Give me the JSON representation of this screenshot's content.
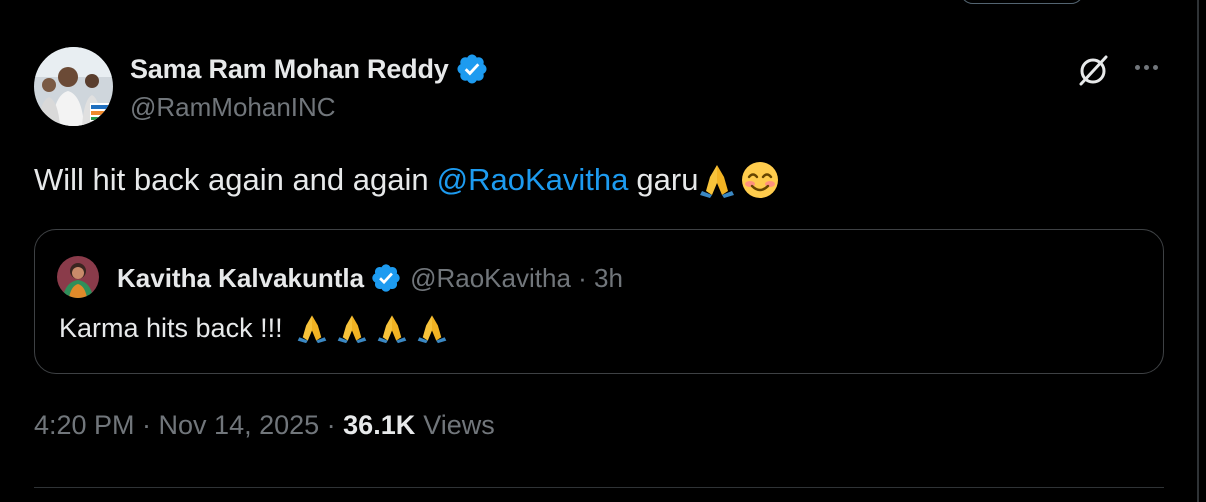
{
  "author": {
    "name": "Sama Ram Mohan Reddy",
    "handle": "@RamMohanINC"
  },
  "tweet": {
    "text_prefix": "Will hit back again and again",
    "mention": "@RaoKavitha",
    "text_suffix": "garu",
    "emojis": [
      "folded-hands",
      "smiling-face-with-smiling-eyes"
    ]
  },
  "quote": {
    "name": "Kavitha Kalvakuntla",
    "handle_time": "@RaoKavitha · 3h",
    "text": "Karma hits back !!!",
    "emojis": [
      "folded-hands",
      "folded-hands",
      "folded-hands",
      "folded-hands"
    ]
  },
  "meta": {
    "time_date": "4:20 PM · Nov 14, 2025 · ",
    "views_count": "36.1K",
    "views_label": "Views"
  },
  "colors": {
    "background": "#000000",
    "text": "#e7e9ea",
    "muted": "#71767b",
    "link": "#1d9bf0",
    "verified": "#1d9bf0",
    "border": "#2f3336"
  },
  "icons": {
    "verified": "verified-badge-icon",
    "grok": "grok-icon",
    "more": "more-icon"
  }
}
